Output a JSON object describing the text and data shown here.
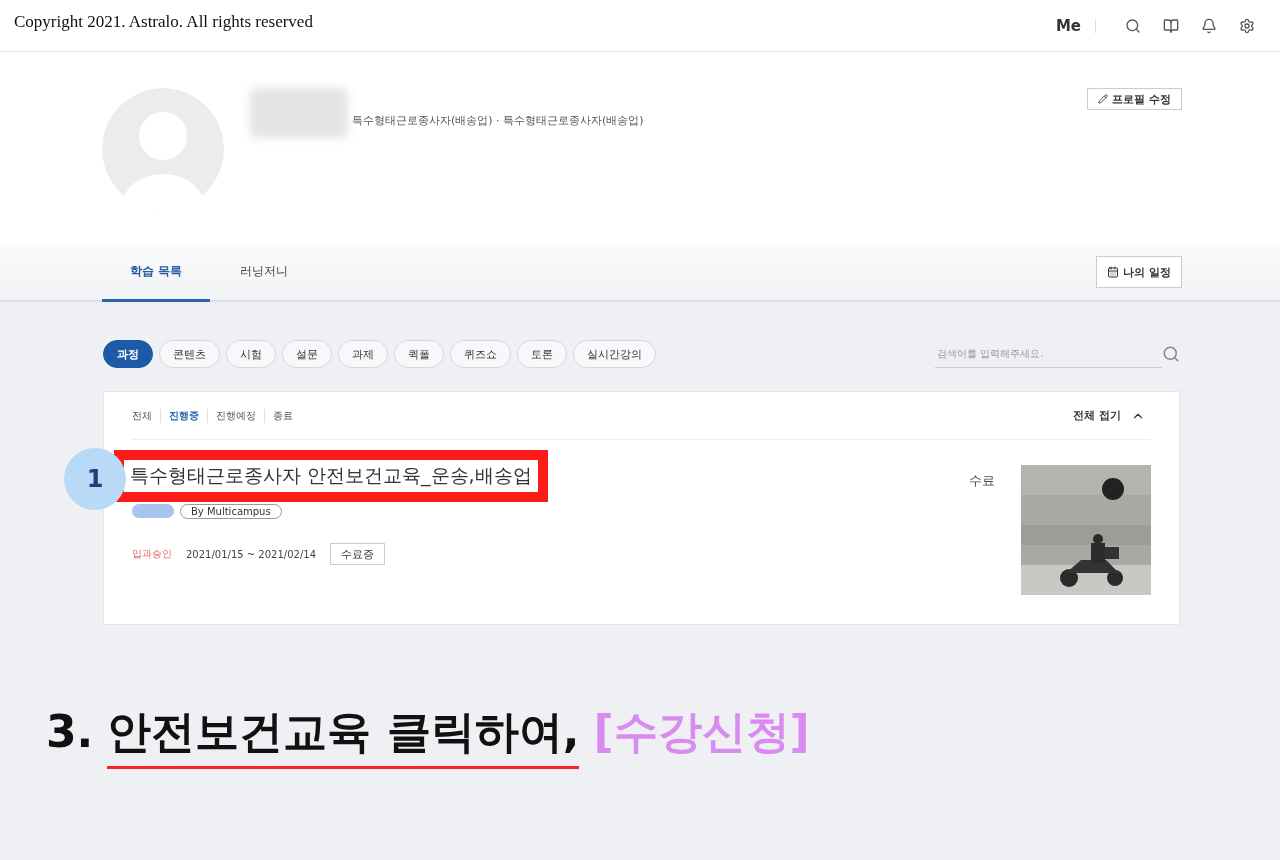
{
  "top_bar": {
    "copyright": "Copyright 2021. Astralo. All rights reserved",
    "user_label": "Me"
  },
  "profile": {
    "affiliation": "특수형태근로종사자(배송업) · 특수형태근로종사자(배송업)",
    "edit_button": "프로필 수정"
  },
  "tabs": [
    {
      "label": "학습 목록",
      "selected": true
    },
    {
      "label": "러닝저니",
      "selected": false
    }
  ],
  "schedule_button": "나의 일정",
  "chips": [
    {
      "label": "과정",
      "selected": true
    },
    {
      "label": "콘텐츠",
      "selected": false
    },
    {
      "label": "시험",
      "selected": false
    },
    {
      "label": "설문",
      "selected": false
    },
    {
      "label": "과제",
      "selected": false
    },
    {
      "label": "퀵폴",
      "selected": false
    },
    {
      "label": "퀴즈쇼",
      "selected": false
    },
    {
      "label": "토론",
      "selected": false
    },
    {
      "label": "실시간강의",
      "selected": false
    }
  ],
  "search": {
    "placeholder": "검색어를 입력해주세요."
  },
  "status_filters": [
    {
      "label": "전체",
      "selected": false
    },
    {
      "label": "진행중",
      "selected": true
    },
    {
      "label": "진행예정",
      "selected": false
    },
    {
      "label": "종료",
      "selected": false
    }
  ],
  "collapse_label": "전체 접기",
  "course": {
    "step": "1",
    "title": "특수형태근로종사자 안전보건교육_운송,배송업",
    "provider": "By Multicampus",
    "approval": "입과승인",
    "period": "2021/01/15 ~ 2021/02/14",
    "status_button": "수료증",
    "completion": "수료"
  },
  "caption": {
    "number": "3.",
    "underlined": "안전보건교육 클릭하여,",
    "highlight": "[수강신청]"
  }
}
